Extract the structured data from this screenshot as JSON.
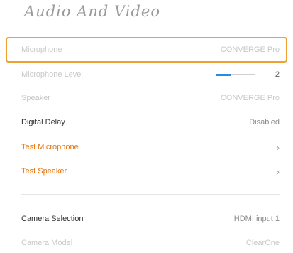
{
  "page": {
    "title": "Audio And Video"
  },
  "rows": {
    "microphone": {
      "label": "Microphone",
      "value": "CONVERGE Pro"
    },
    "microphone_level": {
      "label": "Microphone Level",
      "value": "2",
      "fraction": 0.4
    },
    "speaker": {
      "label": "Speaker",
      "value": "CONVERGE Pro"
    },
    "digital_delay": {
      "label": "Digital Delay",
      "value": "Disabled"
    },
    "test_microphone": {
      "label": "Test Microphone"
    },
    "test_speaker": {
      "label": "Test Speaker"
    },
    "camera_selection": {
      "label": "Camera Selection",
      "value": "HDMI input 1"
    },
    "camera_model": {
      "label": "Camera Model",
      "value": "ClearOne"
    }
  },
  "colors": {
    "accent": "#e8730a",
    "focus": "#f0a030",
    "slider": "#2a8be0"
  },
  "icons": {
    "chevron": "chevron-right-icon"
  }
}
